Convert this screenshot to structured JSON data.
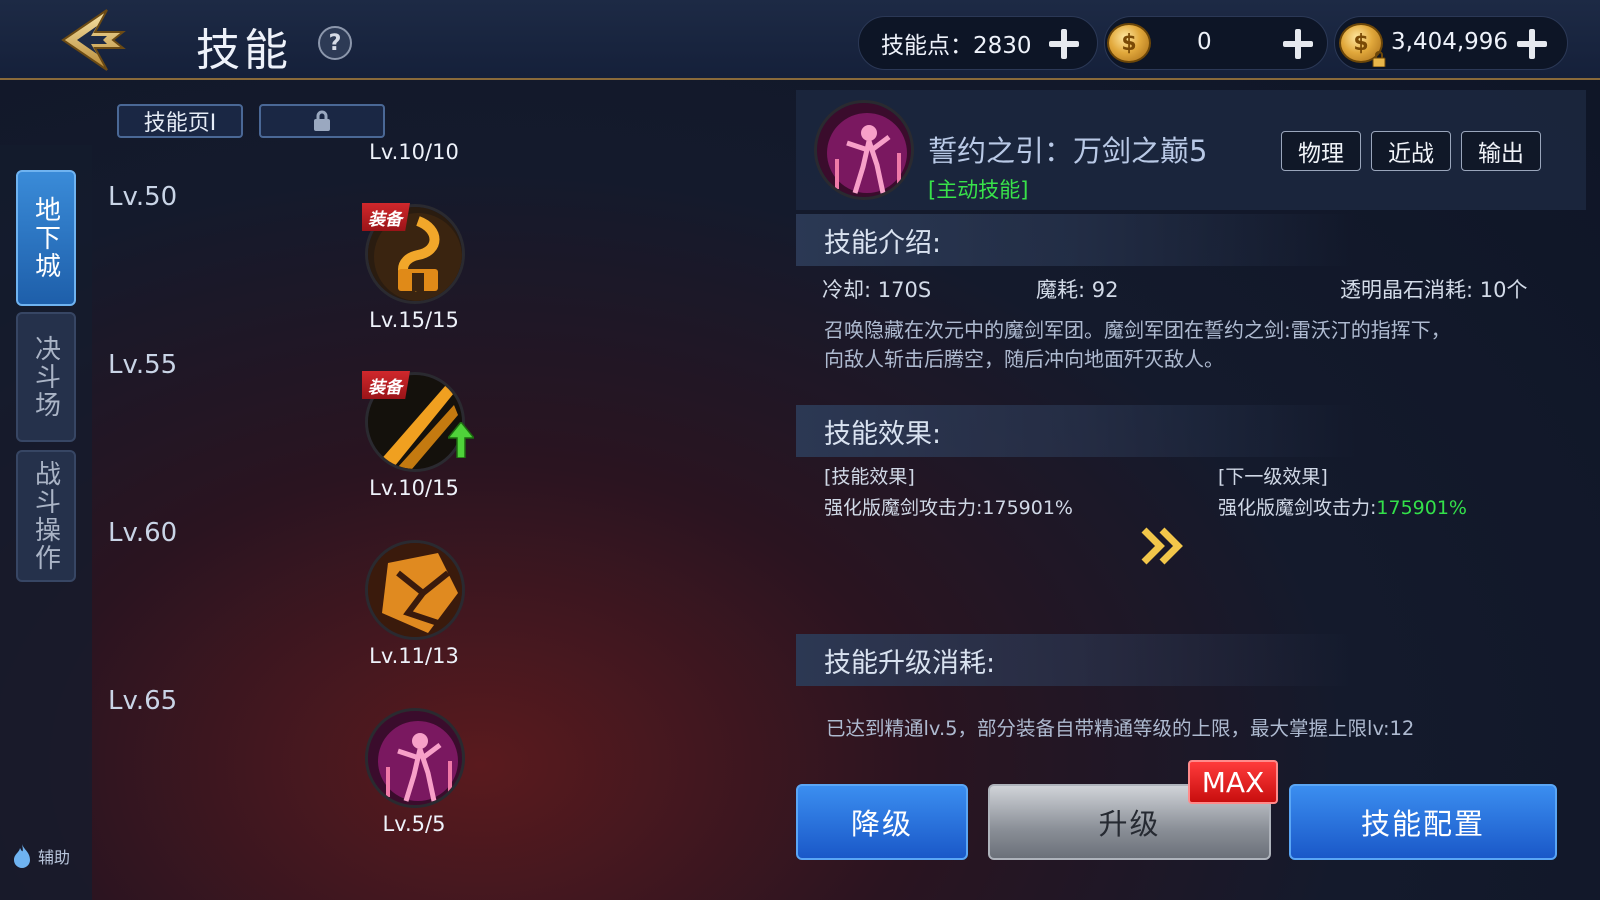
{
  "header": {
    "title": "技能",
    "skill_points_label": "技能点：2830",
    "coin_amount": "0",
    "gold_amount": "3,404,996"
  },
  "left_tabs": [
    {
      "label": "地下城",
      "active": true
    },
    {
      "label": "决斗场",
      "active": false
    },
    {
      "label": "战斗操作",
      "active": false
    }
  ],
  "assist_label": "辅助",
  "skill_pages": {
    "page1": "技能页Ⅰ"
  },
  "skill_tree": {
    "top_level": "Lv.10/10",
    "rows": [
      {
        "level": "Lv.50",
        "skill_level": "Lv.15/15",
        "equipped": true,
        "equip_tag": "装备",
        "theme": "gold-spiral"
      },
      {
        "level": "Lv.55",
        "skill_level": "Lv.10/15",
        "equipped": true,
        "equip_tag": "装备",
        "theme": "slash",
        "upgradable": true
      },
      {
        "level": "Lv.60",
        "skill_level": "Lv.11/13",
        "equipped": false,
        "theme": "break"
      },
      {
        "level": "Lv.65",
        "skill_level": "Lv.5/5",
        "equipped": false,
        "theme": "swordmaster"
      }
    ]
  },
  "detail": {
    "name": "誓约之引：万剑之巅5",
    "type": "[主动技能]",
    "tags": [
      "物理",
      "近战",
      "输出"
    ],
    "intro_heading": "技能介绍:",
    "cooldown": "冷却: 170S",
    "mana": "魔耗: 92",
    "crystal": "透明晶石消耗: 10个",
    "description": [
      "召唤隐藏在次元中的魔剑军团。魔剑军团在誓约之剑:雷沃汀的指挥下，",
      "向敌人斩击后腾空，随后冲向地面歼灭敌人。"
    ],
    "effect_heading": "技能效果:",
    "current_effect_title": "[技能效果]",
    "current_effect_label": "强化版魔剑攻击力:",
    "current_effect_value": "175901%",
    "next_effect_title": "[下一级效果]",
    "next_effect_label": "强化版魔剑攻击力:",
    "next_effect_value": "175901%",
    "cost_heading": "技能升级消耗:",
    "cost_note": "已达到精通lv.5，部分装备自带精通等级的上限，最大掌握上限lv:12"
  },
  "buttons": {
    "downgrade": "降级",
    "upgrade": "升级",
    "max_badge": "MAX",
    "config": "技能配置"
  },
  "colors": {
    "accent_blue": "#1e5faa",
    "skill_type_green": "#38e24a",
    "equip_red": "#c81e22",
    "max_red": "#e01818"
  }
}
